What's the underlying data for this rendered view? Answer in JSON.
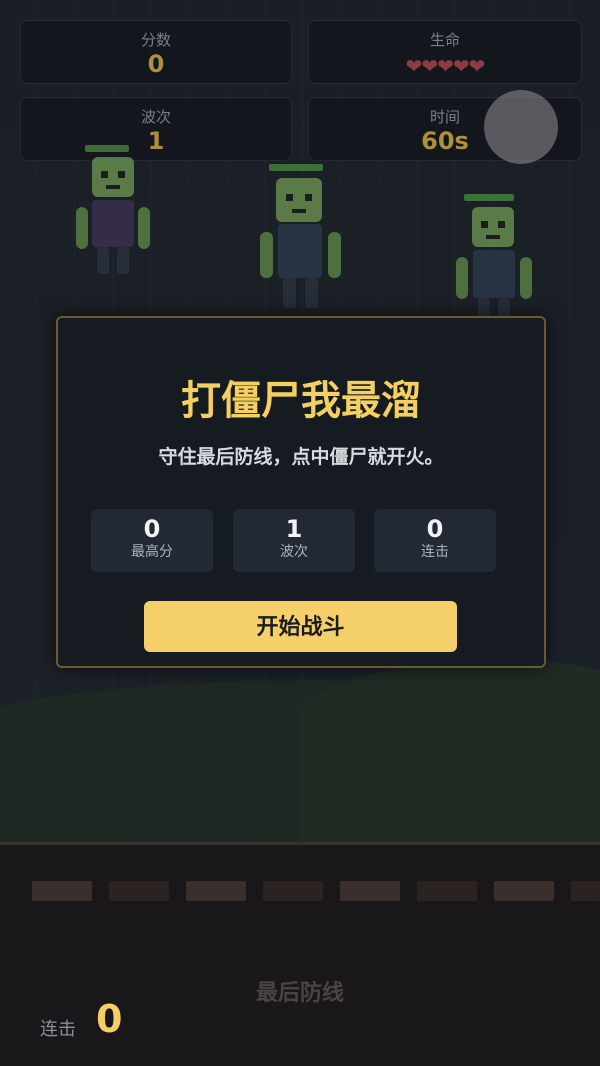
{
  "hud": {
    "score_label": "分数",
    "score_value": "0",
    "lives_label": "生命",
    "lives_hearts": "❤❤❤❤❤",
    "wave_label": "波次",
    "wave_value": "1",
    "time_label": "时间",
    "time_value": "60s"
  },
  "modal": {
    "title": "打僵尸我最溜",
    "subtitle": "守住最后防线，点中僵尸就开火。",
    "stats": [
      {
        "value": "0",
        "label": "最高分"
      },
      {
        "value": "1",
        "label": "波次"
      },
      {
        "value": "0",
        "label": "连击"
      }
    ],
    "start_button": "开始战斗"
  },
  "road": {
    "label": "最后防线",
    "combo_label": "连击",
    "combo_value": "0"
  },
  "colors": {
    "accent": "#f4cf62",
    "button": "#f5cf6a",
    "panel": "#161b22",
    "zombie_skin": "#6f9a52"
  }
}
